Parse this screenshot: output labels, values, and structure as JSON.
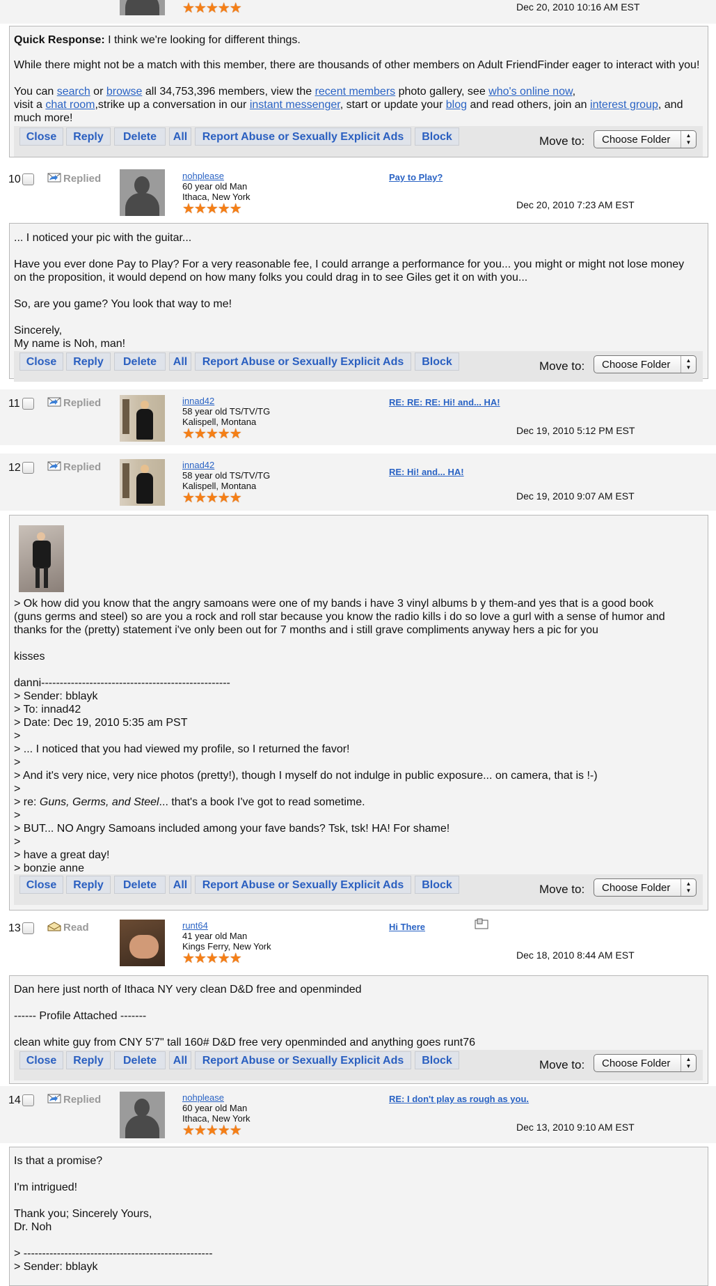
{
  "common": {
    "buttons": {
      "close": "Close",
      "reply": "Reply",
      "delete": "Delete",
      "all": "All",
      "report": "Report Abuse or Sexually Explicit Ads",
      "block": "Block"
    },
    "move_to": "Move to:",
    "folder_select": "Choose Folder",
    "stars": "★★★★★"
  },
  "top": {
    "date": "Dec 20, 2010 10:16 AM EST"
  },
  "quick": {
    "label": "Quick Response:",
    "text": " I think we're looking for different things.",
    "p1": "While there might not be a match with this member, there are thousands of other members on Adult FriendFinder eager to interact with you!",
    "l2a": "You can ",
    "search": "search",
    "l2b": " or ",
    "browse": "browse",
    "l2c": " all 34,753,396 members, view the ",
    "recent": "recent members",
    "l2d": " photo gallery, see ",
    "online": "who's online now",
    "l2e": ",",
    "l3a": "visit a ",
    "chat": "chat room",
    "l3b": ",strike up a conversation in our ",
    "im": "instant messenger",
    "l3c": ", start or update your ",
    "blog": "blog",
    "l3d": " and read others, join an ",
    "interest": "interest group",
    "l3e": ", and",
    "l4": "much more!"
  },
  "messages": [
    {
      "num": "10",
      "status": "Replied",
      "user": "nohplease",
      "age": "60 year old Man",
      "loc": "Ithaca, New York",
      "subject": "Pay to Play?",
      "date": "Dec 20, 2010 7:23 AM EST",
      "body": [
        "... I noticed your pic with the guitar...",
        "",
        "Have you ever done Pay to Play? For a very reasonable fee, I could arrange a performance for you... you might or might not lose money",
        "on the proposition, it would depend on how many folks you could drag in to see Giles get it on with you...",
        "",
        "So, are you game? You look that way to me!",
        "",
        "Sincerely,",
        "My name is Noh, man!"
      ]
    },
    {
      "num": "11",
      "status": "Replied",
      "user": "innad42",
      "age": "58 year old TS/TV/TG",
      "loc": "Kalispell, Montana",
      "subject": "RE: RE: RE: Hi! and... HA!",
      "date": "Dec 19, 2010 5:12 PM EST"
    },
    {
      "num": "12",
      "status": "Replied",
      "user": "innad42",
      "age": "58 year old TS/TV/TG",
      "loc": "Kalispell, Montana",
      "subject": "RE: Hi! and... HA!",
      "date": "Dec 19, 2010 9:07 AM EST",
      "body": [
        "> Ok how did you know that the angry samoans were one of my bands i have 3 vinyl albums b y them-and yes that is a good book",
        "(guns germs and steel) so are you a rock and roll star because you know the radio kills i do so love a gurl with a sense of humor and",
        "thanks for the (pretty) statement i've only been out for 7 months and i still grave compliments anyway hers a pic for you",
        "",
        "kisses",
        "",
        "danni---------------------------------------------------",
        "> Sender: bblayk",
        "> To: innad42",
        "> Date: Dec 19, 2010 5:35 am PST",
        ">",
        "> ... I noticed that you had viewed my profile, so I returned the favor!",
        ">",
        "> And it's very nice, very nice photos (pretty!), though I myself do not indulge in public exposure... on camera, that is !-)",
        ">"
      ],
      "book_pre": "> re: ",
      "book": "Guns, Germs, and Steel",
      "book_post": "... that's a book I've got to read sometime.",
      "body2": [
        ">",
        "> BUT... NO Angry Samoans included among your fave bands? Tsk, tsk! HA! For shame!",
        ">",
        "> have a great day!",
        "> bonzie anne"
      ]
    },
    {
      "num": "13",
      "status": "Read",
      "user": "runt64",
      "age": "41 year old Man",
      "loc": "Kings Ferry, New York",
      "subject": "Hi There",
      "date": "Dec 18, 2010 8:44 AM EST",
      "body": [
        "Dan here just north of Ithaca NY very clean D&D free and openminded",
        "",
        "------ Profile Attached -------",
        "",
        "clean white guy from CNY 5'7\" tall 160# D&D free very openminded and anything goes runt76"
      ]
    },
    {
      "num": "14",
      "status": "Replied",
      "user": "nohplease",
      "age": "60 year old Man",
      "loc": "Ithaca, New York",
      "subject": "RE: I don't play as rough as you.",
      "date": "Dec 13, 2010 9:10 AM EST",
      "body": [
        "Is that a promise?",
        "",
        "I'm intrigued!",
        "",
        "Thank you; Sincerely Yours,",
        "Dr. Noh",
        "",
        "> ---------------------------------------------------",
        "> Sender: bblayk"
      ]
    }
  ]
}
